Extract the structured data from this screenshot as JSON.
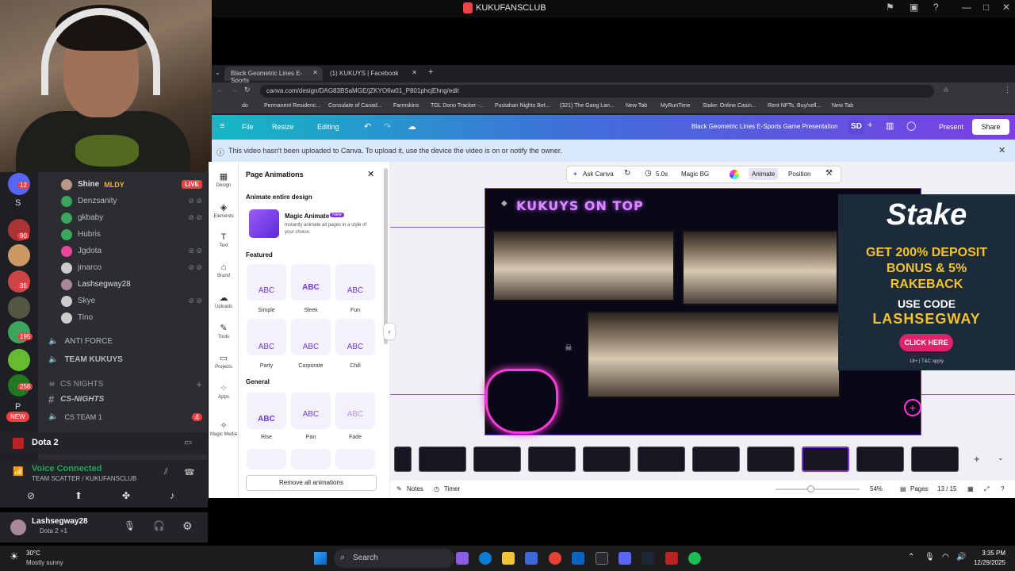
{
  "window": {
    "title": "KUKUFANSCLUB"
  },
  "discord": {
    "members": [
      {
        "name": "Shine",
        "tag": "MLDY",
        "live": "LIVE"
      },
      {
        "name": "Denzsanity"
      },
      {
        "name": "gkbaby"
      },
      {
        "name": "Hubris"
      },
      {
        "name": "Jgdota"
      },
      {
        "name": "jmarco"
      },
      {
        "name": "Lashsegway28"
      },
      {
        "name": "Skye"
      },
      {
        "name": "Tino"
      }
    ],
    "channels": [
      "ANTI FORCE",
      "TEAM KUKUYS"
    ],
    "category": "CS NIGHTS",
    "sub_channels": [
      "CS-NIGHTS",
      "CS TEAM 1"
    ],
    "cs_team_badge": "4",
    "server_badges": [
      "12",
      "90",
      "35",
      "195",
      "256"
    ],
    "new_badge": "NEW",
    "server_letters": [
      "S",
      "P"
    ],
    "game": "Dota 2",
    "voice_status": "Voice Connected",
    "voice_channel": "TEAM SCATTER / KUKUFANSCLUB",
    "user": {
      "name": "Lashsegway28",
      "status": "Dota 2 +1"
    }
  },
  "browser": {
    "tabs": [
      "Black Geometric Lines E-Sports",
      "(1) KUKUYS | Facebook"
    ],
    "url": "canva.com/design/DAG83BSaMGE/jZKYO6w01_P801phcjEhng/edit",
    "bookmarks": [
      "do",
      "Permanent Residenc...",
      "Consulate of Canad...",
      "Farmskins",
      "TGL Dono Tracker -...",
      "Pustahan Nights Bet...",
      "(321) The Gang Lan...",
      "New Tab",
      "MyRunTime",
      "Stake: Online Casin...",
      "Rent NFTs. Buy/sell...",
      "New Tab"
    ]
  },
  "canva": {
    "menu": {
      "file": "File",
      "resize": "Resize",
      "editing": "Editing"
    },
    "design_title": "Black Geometric Lines E-Sports Game Presentation",
    "avatar": "SD",
    "present": "Present",
    "share": "Share",
    "notice": "This video hasn't been uploaded to Canva. To upload it, use the device the video is on or notify the owner.",
    "sidebar": [
      "Design",
      "Elements",
      "Text",
      "Brand",
      "Uploads",
      "Tools",
      "Projects",
      "Apps",
      "Magic Media"
    ],
    "panel": {
      "title": "Page Animations",
      "section_all": "Animate entire design",
      "magic_title": "Magic Animate",
      "magic_badge": "New",
      "magic_desc": "Instantly animate all pages in a style of your choice.",
      "featured": "Featured",
      "featured_items": [
        "Simple",
        "Sleek",
        "Fun",
        "Party",
        "Corporate",
        "Chill"
      ],
      "general": "General",
      "general_items": [
        "Rise",
        "Pan",
        "Fade"
      ],
      "remove": "Remove all animations"
    },
    "toolbar": {
      "ask": "Ask Canva",
      "duration": "5.0s",
      "magic_bg": "Magic BG",
      "animate": "Animate",
      "position": "Position"
    },
    "slide": {
      "title": "KUKUYS ON TOP"
    },
    "bottom": {
      "notes": "Notes",
      "timer": "Timer",
      "zoom": "54%",
      "pages": "Pages",
      "page_count": "13 / 15"
    }
  },
  "ad": {
    "logo": "Stake",
    "line1": "GET 200% DEPOSIT",
    "line2": "BONUS & 5%",
    "line3": "RAKEBACK",
    "use_code": "USE CODE",
    "code": "LASHSEGWAY",
    "cta": "CLICK HERE",
    "tc": "18+ | T&C apply"
  },
  "taskbar": {
    "weather_temp": "30°C",
    "weather_desc": "Mostly sunny",
    "search": "Search",
    "time": "3:35 PM",
    "date": "12/29/2025"
  }
}
